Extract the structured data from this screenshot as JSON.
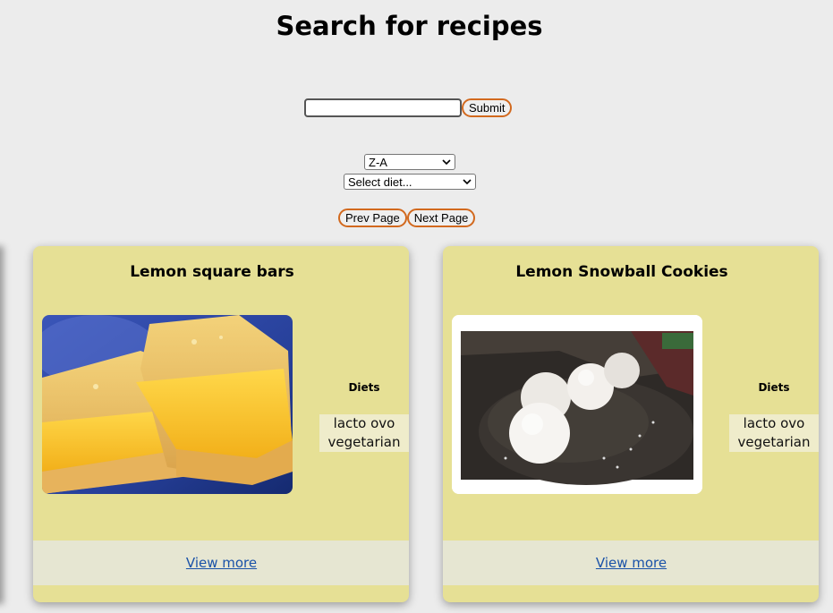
{
  "header": {
    "title": "Search for recipes"
  },
  "search": {
    "value": "",
    "placeholder": "",
    "submit_label": "Submit"
  },
  "filters": {
    "sort_selected": "Z-A",
    "diet_selected": "Select diet..."
  },
  "pagination": {
    "prev_label": "Prev Page",
    "next_label": "Next Page"
  },
  "cards": [
    {
      "title": "Lemon square bars",
      "image_icon": "lemon-bars-photo",
      "diets_label": "Diets",
      "diets": [
        "lacto ovo vegetarian"
      ],
      "link_label": "View more"
    },
    {
      "title": "Lemon Snowball Cookies",
      "image_icon": "snowball-cookies-photo",
      "diets_label": "Diets",
      "diets": [
        "lacto ovo vegetarian"
      ],
      "link_label": "View more"
    }
  ],
  "colors": {
    "background": "#ececec",
    "card": "#e6e095",
    "card_footer": "#e6e6d2",
    "diet_chip": "#efeccb",
    "button_border": "#d2691e",
    "link": "#1a52a8"
  }
}
